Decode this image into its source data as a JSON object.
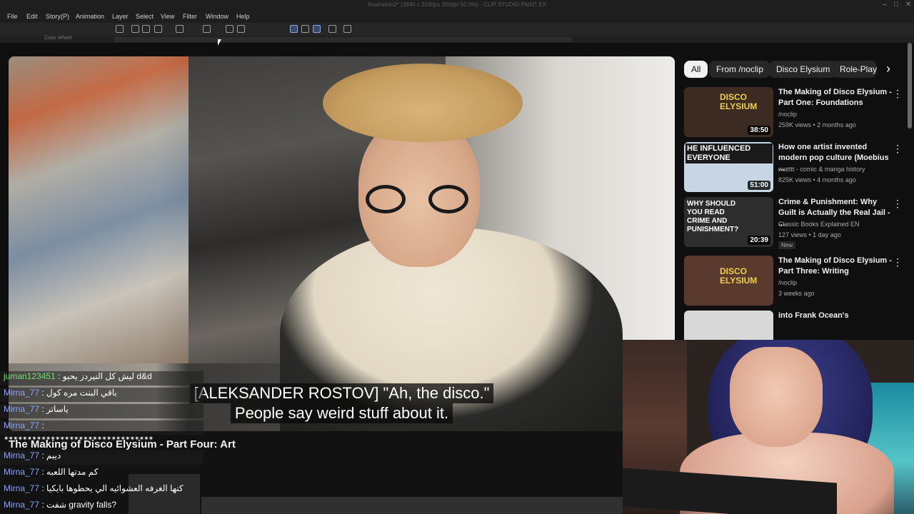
{
  "app": {
    "title": "Illustration2* (3840 x 2160px 350dpi 50.0%) - CLIP STUDIO PAINT EX",
    "menu": [
      "File",
      "Edit",
      "Story(P)",
      "Animation",
      "Layer",
      "Select",
      "View",
      "Filter",
      "Window",
      "Help"
    ],
    "palette_label": "Color Wheel"
  },
  "video": {
    "caption_line1": "[ALEKSANDER ROSTOV] \"Ah, the disco.\"",
    "caption_line2": "People say weird stuff about it.",
    "title": "The Making of Disco Elysium - Part Four: Art"
  },
  "chat": [
    {
      "user": "juman123451",
      "message": "ليش كل النيردز يحبو d&d",
      "user_color": "green"
    },
    {
      "user": "Mirna_77",
      "message": "باقي البنت مره كول"
    },
    {
      "user": "Mirna_77",
      "message": "ياساتر"
    },
    {
      "user": "Mirna_77",
      "message": ""
    },
    {
      "user": "",
      "message": "✴✴✴✴✴✴✴✴✴✴✴✴✴✴✴✴✴✴✴✴✴✴✴✴✴✴✴✴✴✴✴✴"
    },
    {
      "user": "Mirna_77",
      "message": "ديبم"
    },
    {
      "user": "Mirna_77",
      "message": "كم مدتها اللعبه"
    },
    {
      "user": "Mirna_77",
      "message": "كنها الغرفه العشوائيه الي يحطوها بايكيا"
    },
    {
      "user": "Mirna_77",
      "message": "شفت gravity falls?"
    }
  ],
  "sidebar": {
    "chips": [
      "All",
      "From /noclip",
      "Disco Elysium",
      "Role-Play"
    ],
    "recommendations": [
      {
        "title": "The Making of Disco Elysium - Part One: Foundations",
        "channel": "/noclip",
        "meta": "259K views • 2 months ago",
        "duration": "38:50",
        "thumb_text": "DISCO ELYSIUM",
        "thumb_bg": "#3b2b22",
        "thumb_fg": "#f0d04a"
      },
      {
        "title": "How one artist invented modern pop culture (Moebius ...",
        "channel": "matttt - comic & manga history",
        "meta": "825K views • 4 months ago",
        "duration": "51:00",
        "thumb_text": "HE INFLUENCED EVERYONE",
        "thumb_bg": "#c8d5e5",
        "thumb_fg": "#1a1a1a"
      },
      {
        "title": "Crime & Punishment: Why Guilt is Actually the Real Jail - ...",
        "channel": "Classic Books Explained EN",
        "meta": "127 views • 1 day ago",
        "duration": "20:39",
        "badge": "New",
        "thumb_text": "WHY SHOULD YOU READ CRIME AND PUNISHMENT?",
        "thumb_bg": "#2d2d2d",
        "thumb_fg": "#ffffff"
      },
      {
        "title": "The Making of Disco Elysium - Part Three: Writing",
        "channel": "/noclip",
        "meta": "3 weeks ago",
        "duration": "",
        "thumb_text": "DISCO ELYSIUM",
        "thumb_bg": "#5a3a2e",
        "thumb_fg": "#f0d04a"
      },
      {
        "title": "into Frank Ocean's",
        "channel": "",
        "meta": "",
        "duration": "",
        "thumb_text": "",
        "thumb_bg": "#d8d8d8",
        "thumb_fg": "#000000"
      }
    ]
  }
}
